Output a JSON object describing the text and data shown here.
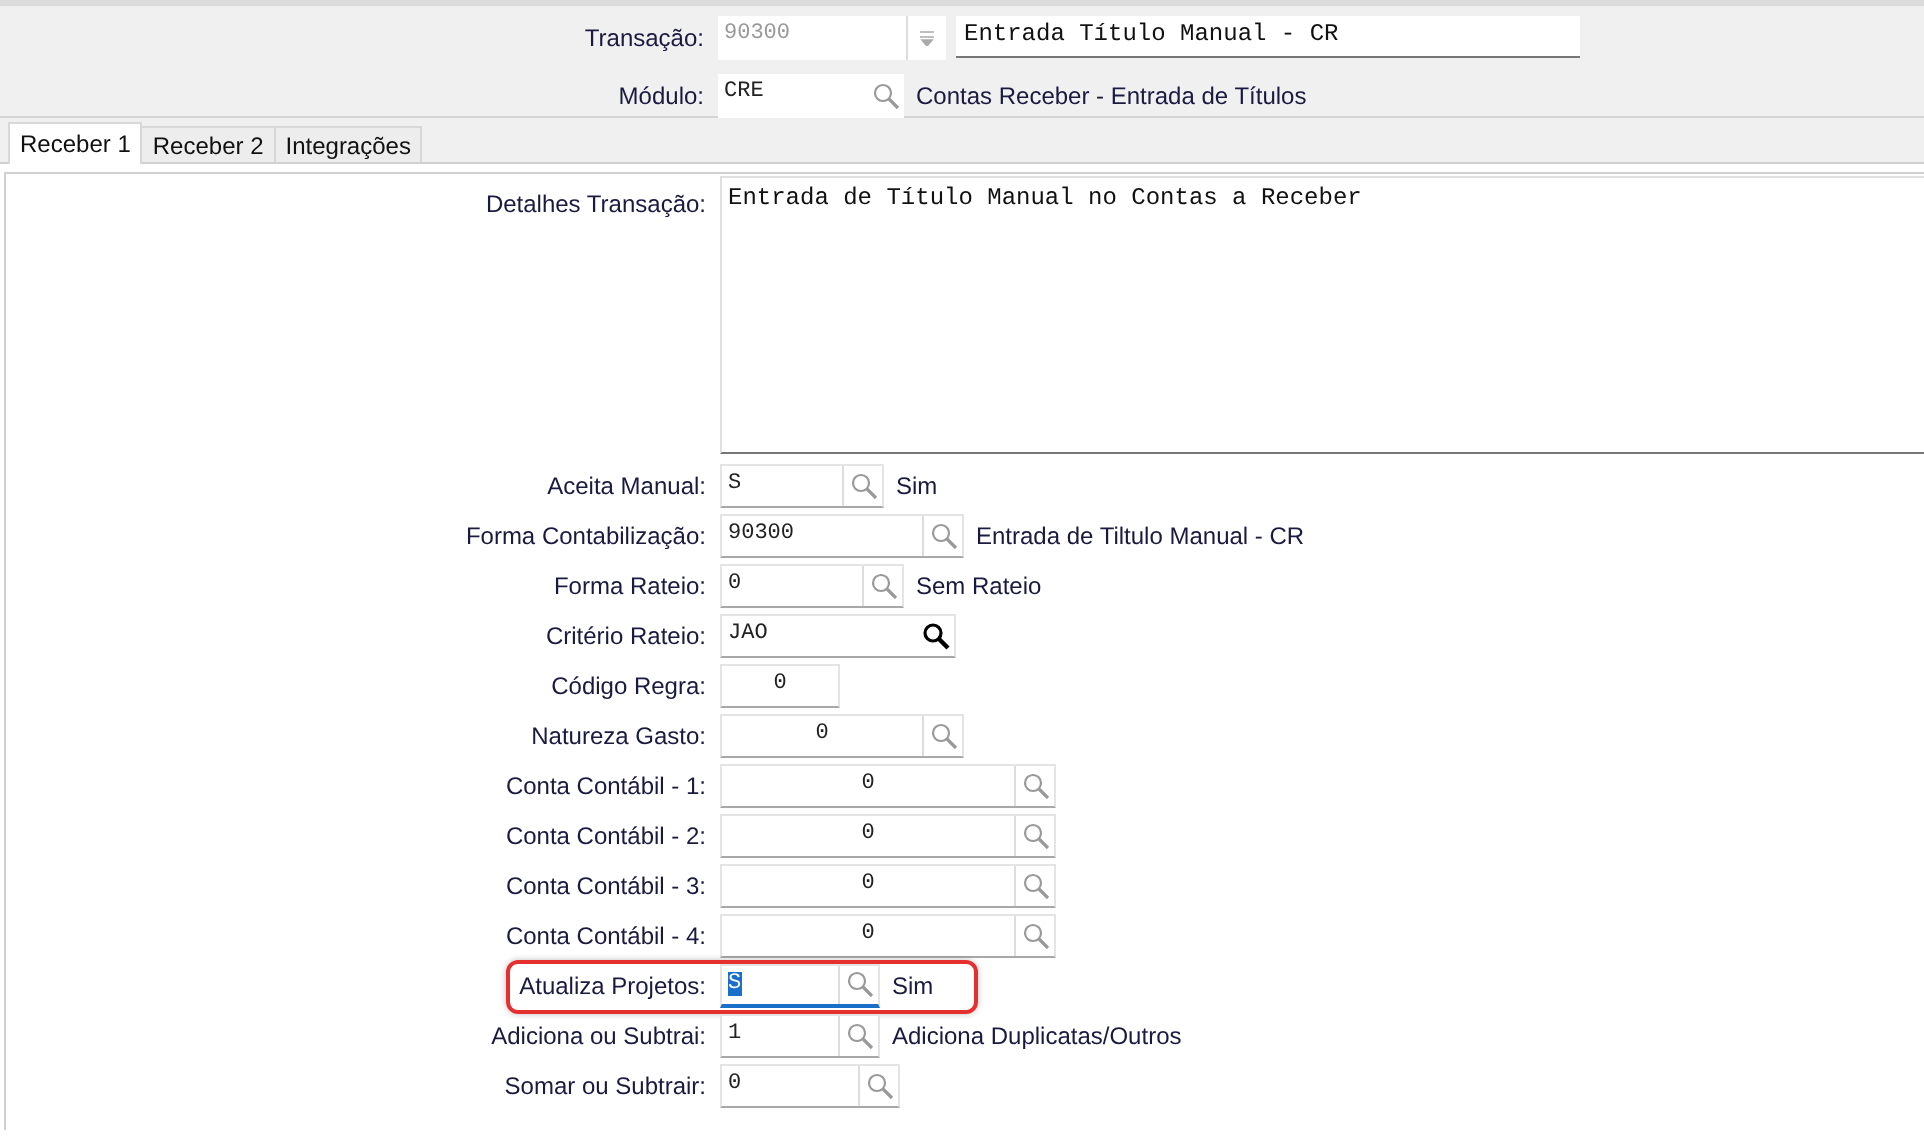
{
  "header": {
    "transacao": {
      "label": "Transação:",
      "value": "90300",
      "disabled": true,
      "description": "Entrada Título Manual - CR"
    },
    "modulo": {
      "label": "Módulo:",
      "value": "CRE",
      "description": "Contas Receber - Entrada de Títulos"
    }
  },
  "tabs": [
    {
      "label": "Receber 1",
      "selected": true
    },
    {
      "label": "Receber 2",
      "selected": false
    },
    {
      "label": "Integrações",
      "selected": false
    }
  ],
  "details": {
    "label": "Detalhes Transação:",
    "value": "Entrada de Título Manual no Contas a Receber"
  },
  "rows": [
    {
      "label": "Aceita Manual:",
      "value": "S",
      "kind": "lookup",
      "description": "Sim",
      "highlighted": false,
      "focused": false
    },
    {
      "label": "Forma Contabilização:",
      "value": "90300",
      "kind": "lookup",
      "description": "Entrada de Tiltulo Manual - CR",
      "highlighted": false,
      "focused": false
    },
    {
      "label": "Forma Rateio:",
      "value": "0",
      "kind": "lookup",
      "description": "Sem Rateio",
      "highlighted": false,
      "focused": false
    },
    {
      "label": "Critério Rateio:",
      "value": "JAO",
      "kind": "lookup-dark",
      "highlighted": false,
      "focused": false
    },
    {
      "label": "Código Regra:",
      "value": "0",
      "kind": "plain",
      "highlighted": false,
      "focused": false
    },
    {
      "label": "Natureza Gasto:",
      "value": "0",
      "kind": "lookup",
      "highlighted": false,
      "focused": false
    },
    {
      "label": "Conta Contábil - 1:",
      "value": "0",
      "kind": "lookup",
      "highlighted": false,
      "focused": false
    },
    {
      "label": "Conta Contábil - 2:",
      "value": "0",
      "kind": "lookup",
      "highlighted": false,
      "focused": false
    },
    {
      "label": "Conta Contábil - 3:",
      "value": "0",
      "kind": "lookup",
      "highlighted": false,
      "focused": false
    },
    {
      "label": "Conta Contábil - 4:",
      "value": "0",
      "kind": "lookup",
      "highlighted": false,
      "focused": false
    },
    {
      "label": "Atualiza Projetos:",
      "value": "S",
      "kind": "lookup",
      "description": "Sim",
      "highlighted": true,
      "focused": true
    },
    {
      "label": "Adiciona ou Subtrai:",
      "value": "1",
      "kind": "lookup",
      "description": "Adiciona Duplicatas/Outros",
      "highlighted": false,
      "focused": false
    },
    {
      "label": "Somar ou Subtrair:",
      "value": "0",
      "kind": "lookup",
      "highlighted": false,
      "focused": false
    }
  ]
}
